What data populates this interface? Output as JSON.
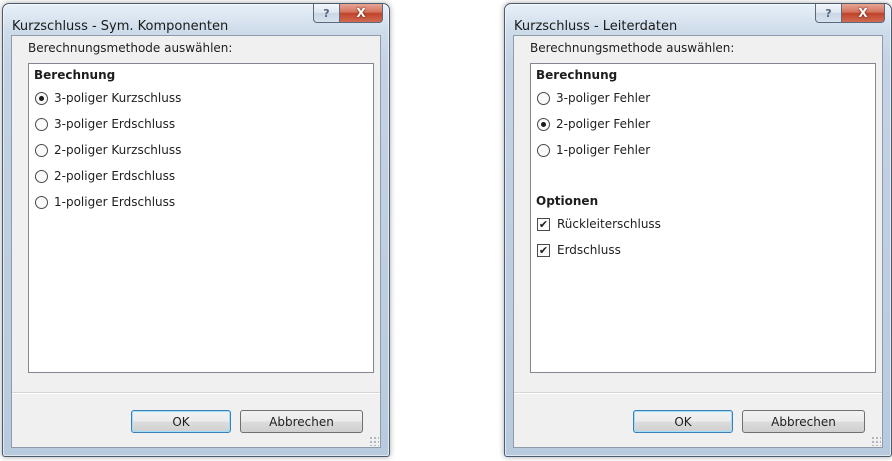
{
  "dialog_sym": {
    "title": "Kurzschluss - Sym. Komponenten",
    "prompt": "Berechnungsmethode auswählen:",
    "section_berechnung": "Berechnung",
    "options": [
      {
        "label": "3-poliger Kurzschluss",
        "checked": true
      },
      {
        "label": "3-poliger Erdschluss",
        "checked": false
      },
      {
        "label": "2-poliger Kurzschluss",
        "checked": false
      },
      {
        "label": "2-poliger Erdschluss",
        "checked": false
      },
      {
        "label": "1-poliger Erdschluss",
        "checked": false
      }
    ],
    "ok_label": "OK",
    "cancel_label": "Abbrechen",
    "help_glyph": "?",
    "close_glyph": "X"
  },
  "dialog_leiter": {
    "title": "Kurzschluss - Leiterdaten",
    "prompt": "Berechnungsmethode auswählen:",
    "section_berechnung": "Berechnung",
    "options": [
      {
        "label": "3-poliger Fehler",
        "checked": false
      },
      {
        "label": "2-poliger Fehler",
        "checked": true
      },
      {
        "label": "1-poliger Fehler",
        "checked": false
      }
    ],
    "section_optionen": "Optionen",
    "checkboxes": [
      {
        "label": "Rückleiterschluss",
        "checked": true
      },
      {
        "label": "Erdschluss",
        "checked": true
      }
    ],
    "ok_label": "OK",
    "cancel_label": "Abbrechen",
    "help_glyph": "?",
    "close_glyph": "X"
  },
  "glyphs": {
    "check": "✔"
  },
  "colors": {
    "title_gradient_top": "#e9f1f9",
    "frame_border": "#4b5c6e",
    "close_red": "#c0432a",
    "ok_focus_border": "#3c7fb1",
    "client_bg": "#f0f0f0"
  }
}
